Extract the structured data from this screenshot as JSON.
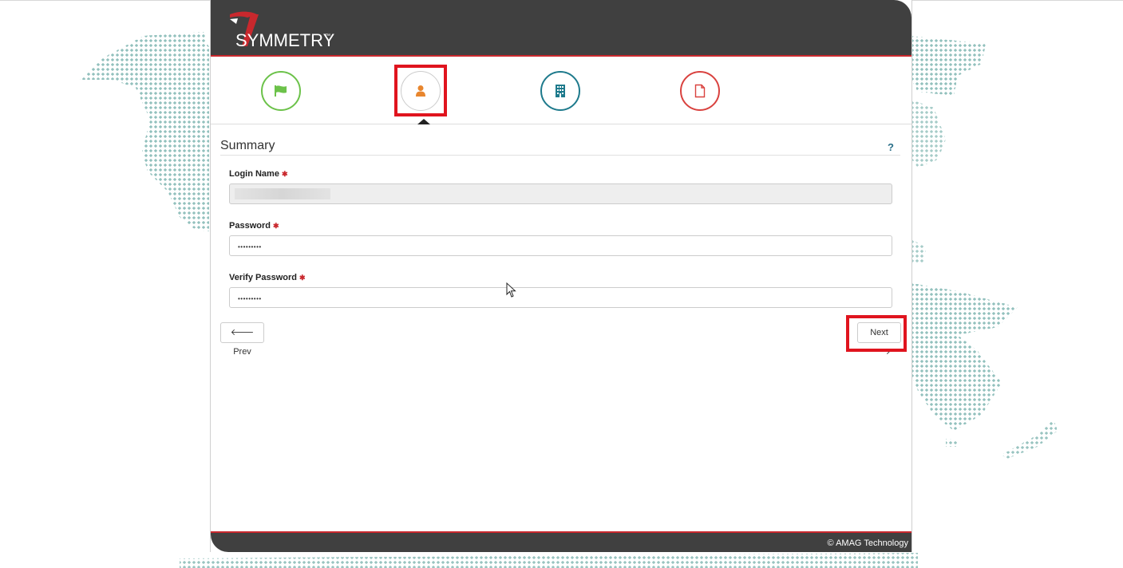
{
  "app": {
    "logo_text": "SYMMETRY",
    "logo_tm": "™"
  },
  "steps": [
    {
      "icon": "flag-icon",
      "color": "#6cc24a"
    },
    {
      "icon": "user-icon",
      "color": "#e8862e",
      "active": true
    },
    {
      "icon": "building-icon",
      "color": "#1e7a8c"
    },
    {
      "icon": "document-icon",
      "color": "#d9423f"
    }
  ],
  "form": {
    "title": "Summary",
    "help": "?",
    "required_mark": "✱",
    "login_name": {
      "label": "Login Name",
      "value": ""
    },
    "password": {
      "label": "Password",
      "value": "•••••••••"
    },
    "verify_password": {
      "label": "Verify Password",
      "value": "•••••••••"
    }
  },
  "buttons": {
    "prev": "Prev",
    "next": "Next"
  },
  "footer": {
    "copyright": "© AMAG Technology"
  },
  "colors": {
    "accent_red": "#c9282d",
    "header_bg": "#404040",
    "dot_color": "#4f9a94"
  }
}
